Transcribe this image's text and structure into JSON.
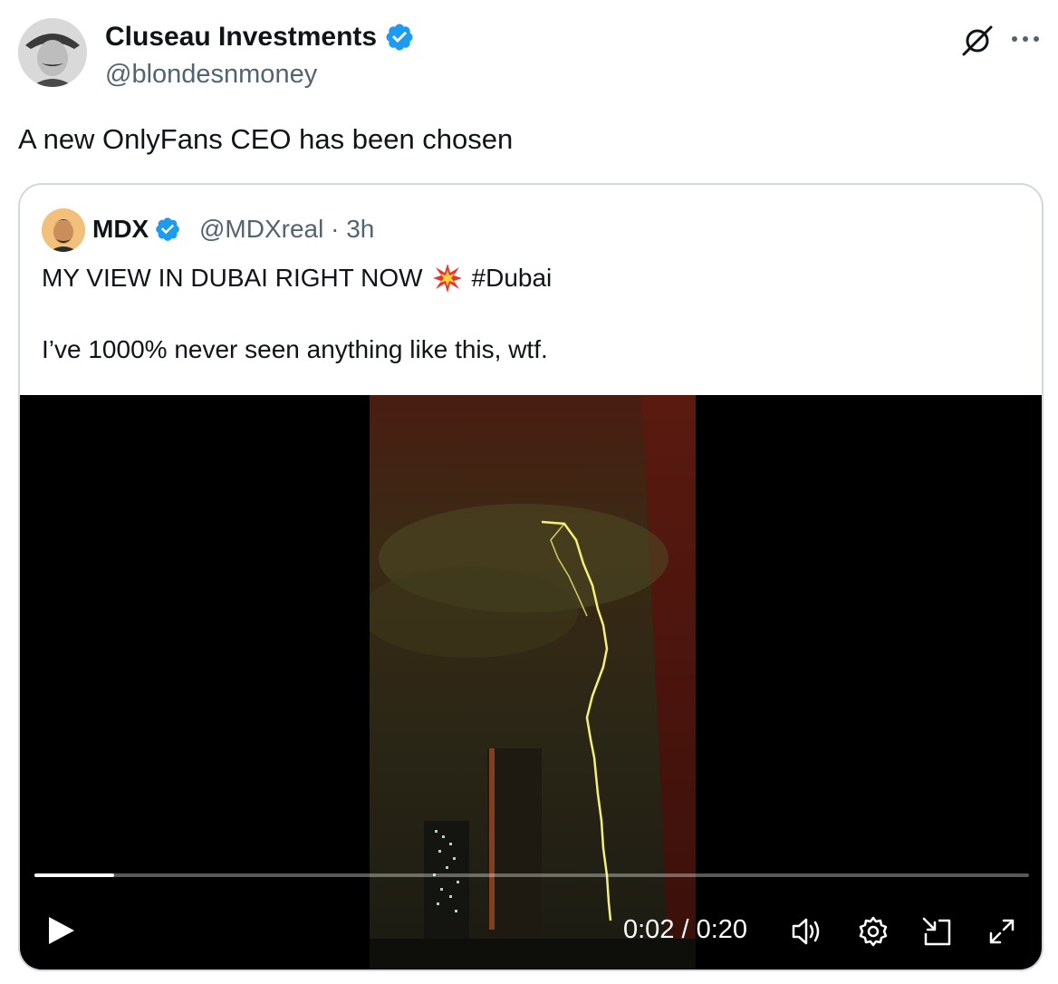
{
  "post": {
    "author_name": "Cluseau Investments",
    "author_handle": "@blondesnmoney",
    "text": "A new OnlyFans CEO has been chosen"
  },
  "quote": {
    "author_name": "MDX",
    "author_handle_time": "@MDXreal · 3h",
    "line1_text": "MY VIEW IN DUBAI RIGHT NOW",
    "hashtag": "#Dubai",
    "line2": "I’ve 1000% never seen anything like this, wtf."
  },
  "video": {
    "time_display": "0:02 / 0:20",
    "progress": 0.08
  },
  "colors": {
    "verified": "#1d9bf0",
    "text": "#0f1419",
    "secondary": "#536471",
    "border": "#cfd9de"
  },
  "icons": [
    "verified-badge-icon",
    "grok-icon",
    "more-icon",
    "collision-emoji-icon",
    "play-icon",
    "volume-icon",
    "settings-icon",
    "pip-icon",
    "fullscreen-icon"
  ]
}
